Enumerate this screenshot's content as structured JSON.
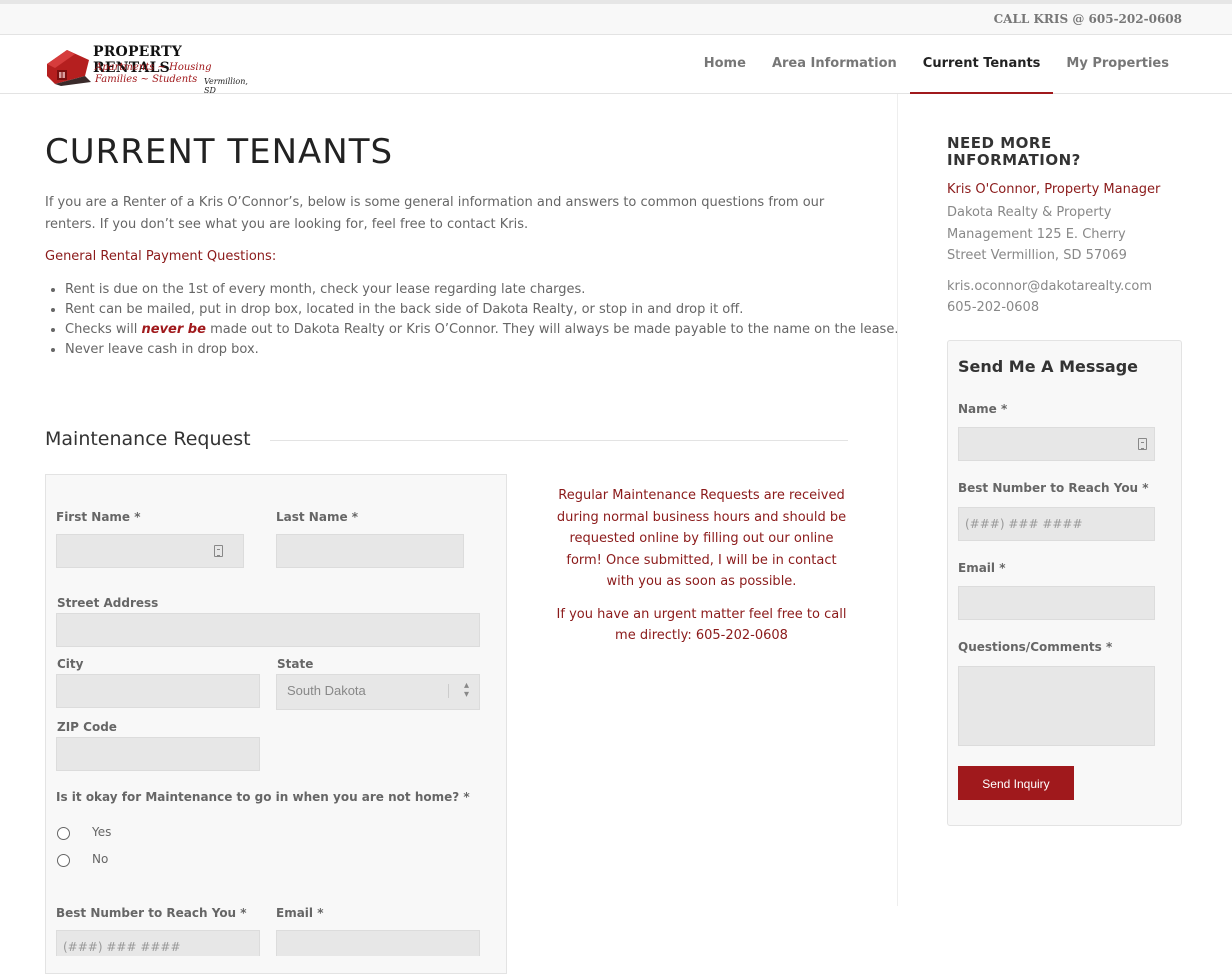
{
  "topbar": {
    "call": "CALL KRIS @ 605-202-0608"
  },
  "logo": {
    "line1": "PROPERTY RENTALS",
    "line2": "Apartments ~ Housing",
    "line3": "Families ~ Students",
    "line4": "Vermillion, SD"
  },
  "nav": {
    "items": [
      {
        "label": "Home"
      },
      {
        "label": "Area Information"
      },
      {
        "label": "Current Tenants",
        "active": true
      },
      {
        "label": "My Properties"
      }
    ]
  },
  "main": {
    "title": "CURRENT TENANTS",
    "intro": "If you are a Renter of a Kris O’Connor’s, below is some general information and answers to common questions from our renters. If you don’t see what you are looking for, feel free to contact Kris.",
    "general_heading": "General Rental Payment Questions:",
    "bullets": {
      "b1": "Rent is due on the 1st of every month, check your lease regarding late charges.",
      "b2": "Rent can be mailed, put in drop box, located in the back side of Dakota Realty, or stop in and drop it off.",
      "b3_pre": "Checks will ",
      "b3_em": "never be",
      "b3_post": " made out to Dakota Realty or Kris O’Connor. They will always be made payable to the name on the lease.",
      "b4": "Never leave cash in drop box."
    },
    "maintenance_title": "Maintenance Request"
  },
  "form": {
    "first_name": "First Name",
    "last_name": "Last Name",
    "street": "Street Address",
    "city": "City",
    "state": "State",
    "state_value": "South Dakota",
    "zip": "ZIP Code",
    "question": "Is it okay for Maintenance to go in when you are not home?",
    "yes": "Yes",
    "no": "No",
    "best_number": "Best Number to Reach You",
    "best_number_placeholder": "(###) ### ####",
    "email": "Email",
    "required_mark": "*"
  },
  "notice": {
    "p1": "Regular Maintenance Requests are received during normal business hours and should be requested online by filling out our online form! Once submitted, I will be in contact with you as soon as possible.",
    "p2": "If you have an urgent matter feel free to call me directly:  605-202-0608"
  },
  "sidebar": {
    "heading": "NEED MORE INFORMATION?",
    "manager": "Kris O'Connor, Property Manager",
    "address": "Dakota Realty & Property Management 125 E. Cherry Street Vermillion, SD 57069",
    "email": "kris.oconnor@dakotarealty.com",
    "phone": "605-202-0608",
    "message_title": "Send Me A Message",
    "name_label": "Name",
    "number_label": "Best Number to Reach You",
    "number_placeholder": "(###) ### ####",
    "email_label": "Email",
    "comments_label": "Questions/Comments",
    "send_button": "Send Inquiry"
  },
  "colors": {
    "accent": "#a0191c"
  }
}
